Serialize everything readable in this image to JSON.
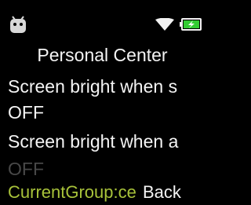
{
  "status_bar": {
    "left_icon": "android-robot-icon",
    "wifi_icon": "wifi-signal-icon",
    "battery_icon": "battery-charging-icon",
    "battery_color": "#33cc33"
  },
  "screen": {
    "title": "Personal Center",
    "items": [
      {
        "label": "Screen bright when s",
        "state": "normal"
      },
      {
        "label": "OFF",
        "state": "normal"
      },
      {
        "label": "Screen bright when a",
        "state": "normal"
      },
      {
        "label": "OFF",
        "state": "dimmed"
      }
    ]
  },
  "footer": {
    "group_label": "CurrentGroup:ce",
    "group_color": "#a8c23a",
    "back_label": "Back"
  }
}
